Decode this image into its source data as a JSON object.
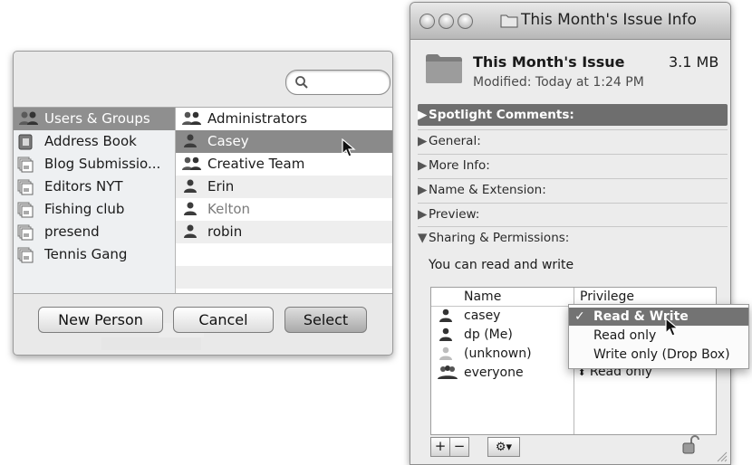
{
  "picker": {
    "search": {
      "placeholder": ""
    },
    "sources": [
      {
        "label": "Users & Groups",
        "icon": "users-groups-icon",
        "selected": true
      },
      {
        "label": "Address Book",
        "icon": "address-book-icon"
      },
      {
        "label": "Blog Submissio...",
        "icon": "group-card-icon"
      },
      {
        "label": "Editors NYT",
        "icon": "group-card-icon"
      },
      {
        "label": "Fishing club",
        "icon": "group-card-icon"
      },
      {
        "label": "presend",
        "icon": "group-card-icon"
      },
      {
        "label": "Tennis Gang",
        "icon": "group-card-icon"
      }
    ],
    "names": [
      {
        "label": "Administrators",
        "icon": "group-icon"
      },
      {
        "label": "Casey",
        "icon": "person-icon",
        "selected": true
      },
      {
        "label": "Creative Team",
        "icon": "group-icon"
      },
      {
        "label": "Erin",
        "icon": "person-icon"
      },
      {
        "label": "Kelton",
        "icon": "person-icon",
        "dim": true
      },
      {
        "label": "robin",
        "icon": "person-icon"
      }
    ],
    "buttons": {
      "new_person": "New Person",
      "cancel": "Cancel",
      "select": "Select"
    }
  },
  "info": {
    "window_title": "This Month's Issue Info",
    "file_name": "This Month's Issue",
    "file_size": "3.1 MB",
    "modified": "Modified: Today at 1:24 PM",
    "sections": {
      "spotlight": "Spotlight Comments:",
      "general": "General:",
      "more_info": "More Info:",
      "name_ext": "Name & Extension:",
      "preview": "Preview:",
      "sharing": "Sharing & Permissions:"
    },
    "permission_status": "You can read and write",
    "table": {
      "col_name": "Name",
      "col_privilege": "Privilege",
      "rows": [
        {
          "name": "casey",
          "icon": "person-icon"
        },
        {
          "name": "dp (Me)",
          "icon": "person-icon"
        },
        {
          "name": "(unknown)",
          "icon": "unknown-person-icon"
        },
        {
          "name": "everyone",
          "icon": "group-icon",
          "privilege": "Read only"
        }
      ]
    },
    "toolbar": {
      "add": "+",
      "remove": "−"
    }
  },
  "privilege_menu": {
    "items": [
      {
        "label": "Read & Write",
        "checked": true,
        "highlighted": true
      },
      {
        "label": "Read only"
      },
      {
        "label": "Write only (Drop Box)"
      }
    ],
    "check_glyph": "✓"
  },
  "colors": {
    "selection": "#8a8a8a",
    "menu_highlight": "#737373",
    "spotlight_bar": "#6e6e6e"
  }
}
